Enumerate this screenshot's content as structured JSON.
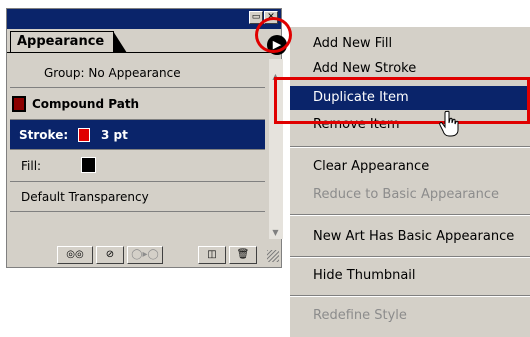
{
  "panel": {
    "tab_label": "Appearance",
    "titlebar_buttons": [
      "min-icon",
      "close-icon"
    ],
    "menu_button_icon": "play-circle-icon",
    "rows": {
      "group": "Group: No Appearance",
      "compound": "Compound Path",
      "stroke_label": "Stroke:",
      "stroke_value": "3 pt",
      "fill_label": "Fill:",
      "transparency": "Default Transparency"
    },
    "bottom_buttons": [
      "new-art-basic-icon",
      "clear-appearance-icon",
      "reduce-basic-icon",
      "duplicate-item-icon",
      "delete-icon"
    ]
  },
  "menu": {
    "items": [
      {
        "label": "Add New Fill",
        "enabled": true
      },
      {
        "label": "Add New Stroke",
        "enabled": true
      },
      {
        "label": "Duplicate Item",
        "enabled": true,
        "highlighted": true
      },
      {
        "label": "Remove Item",
        "enabled": true
      },
      {
        "label": "Clear Appearance",
        "enabled": true
      },
      {
        "label": "Reduce to Basic Appearance",
        "enabled": false
      },
      {
        "label": "New Art Has Basic Appearance",
        "enabled": true
      },
      {
        "label": "Hide Thumbnail",
        "enabled": true
      },
      {
        "label": "Redefine Style",
        "enabled": false
      }
    ]
  },
  "colors": {
    "selection": "#0a246a",
    "annotation": "#e00000",
    "panel_bg": "#d4d0c8",
    "disabled_text": "#8c8c8c"
  }
}
